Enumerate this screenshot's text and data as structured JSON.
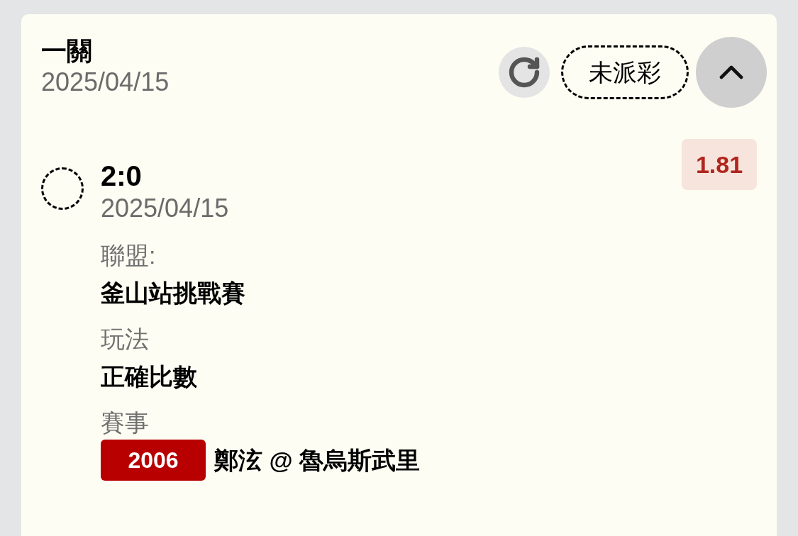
{
  "bet": {
    "title": "一關",
    "date": "2025/04/15",
    "status": "未派彩",
    "expanded": true,
    "selection": {
      "checked": false,
      "score": "2:0",
      "date": "2025/04/15",
      "odds": "1.81",
      "fields": [
        {
          "label": "聯盟:",
          "value": "釜山站挑戰賽"
        },
        {
          "label": "玩法",
          "value": "正確比數"
        },
        {
          "label": "賽事",
          "match_no": "2006",
          "value": "鄭泫 @ 魯烏斯武里"
        }
      ]
    }
  }
}
